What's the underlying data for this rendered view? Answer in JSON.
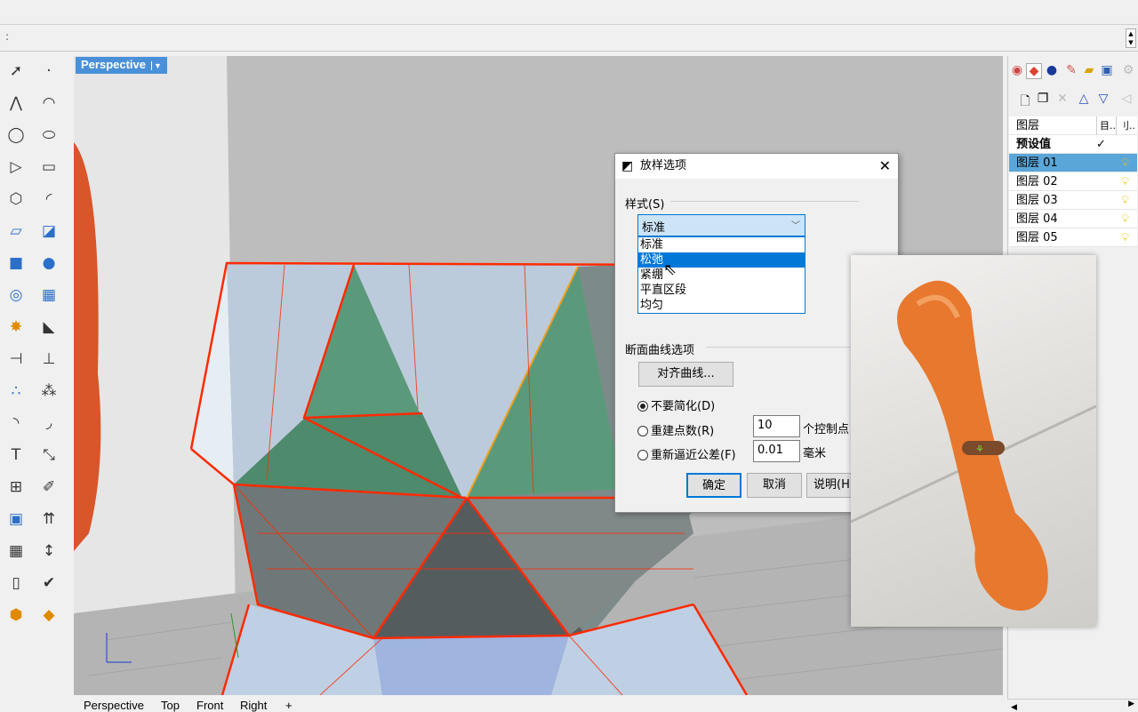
{
  "viewport": {
    "label": "Perspective",
    "tabs": [
      "Perspective",
      "Top",
      "Front",
      "Right"
    ],
    "add_tab": "+"
  },
  "command": {
    "prompt": ":"
  },
  "left_toolbar": {
    "icons": [
      "select-arrow-icon",
      "point-icon",
      "polyline-icon",
      "curve-icon",
      "circle-icon",
      "ellipse-icon",
      "polygon-tri-icon",
      "rectangle-icon",
      "polygon-icon",
      "fillet-curve-icon",
      "surface-icon",
      "extrude-surface-icon",
      "box-icon",
      "sphere-icon",
      "cylinder-icon",
      "mesh-icon",
      "explode-icon",
      "boolean-icon",
      "split-icon",
      "trim-icon",
      "group-icon",
      "array-icon",
      "arc-icon",
      "offset-icon",
      "text-icon",
      "transform-icon",
      "snap-icon",
      "edit-icon",
      "solid-tools-icon",
      "dimension-icon",
      "grid-icon",
      "gumball-icon",
      "panel-icon",
      "check-icon",
      "render-icon",
      "material-icon"
    ]
  },
  "right_panel": {
    "tab_icons": [
      "color-wheel-icon",
      "layers-icon",
      "material-ball-icon",
      "render-tool-icon",
      "folder-icon",
      "help-icon",
      "gear-icon"
    ],
    "toolbar_icons": [
      "new-layer-icon",
      "new-sublayer-icon",
      "delete-icon",
      "move-up-icon",
      "move-down-icon",
      "collapse-icon"
    ],
    "columns": [
      "图层",
      "目..",
      "刂.."
    ],
    "default_row": {
      "name": "预设值",
      "mark": "✓"
    },
    "layers": [
      {
        "name": "图层 01",
        "selected": true
      },
      {
        "name": "图层 02"
      },
      {
        "name": "图层 03"
      },
      {
        "name": "图层 04"
      },
      {
        "name": "图层 05"
      }
    ]
  },
  "dialog": {
    "title": "放样选项",
    "close": "✕",
    "style_label": "样式(S)",
    "style_value": "标准",
    "style_options": [
      "标准",
      "松弛",
      "紧绷",
      "平直区段",
      "均匀"
    ],
    "highlighted_option": "松弛",
    "section_label": "断面曲线选项",
    "align_button": "对齐曲线...",
    "radio_no_simplify": "不要简化(D)",
    "radio_rebuild": "重建点数(R)",
    "rebuild_value": "10",
    "rebuild_unit": "个控制点",
    "radio_refit": "重新逼近公差(F)",
    "refit_value": "0.01",
    "refit_unit": "毫米",
    "ok": "确定",
    "cancel": "取消",
    "help": "说明(H)"
  },
  "colors": {
    "accent": "#0078d7",
    "viewport_label": "#4a90d9",
    "edge": "#ff2a00",
    "face_green": "#5a9a7a",
    "object_orange": "#e8782e"
  }
}
